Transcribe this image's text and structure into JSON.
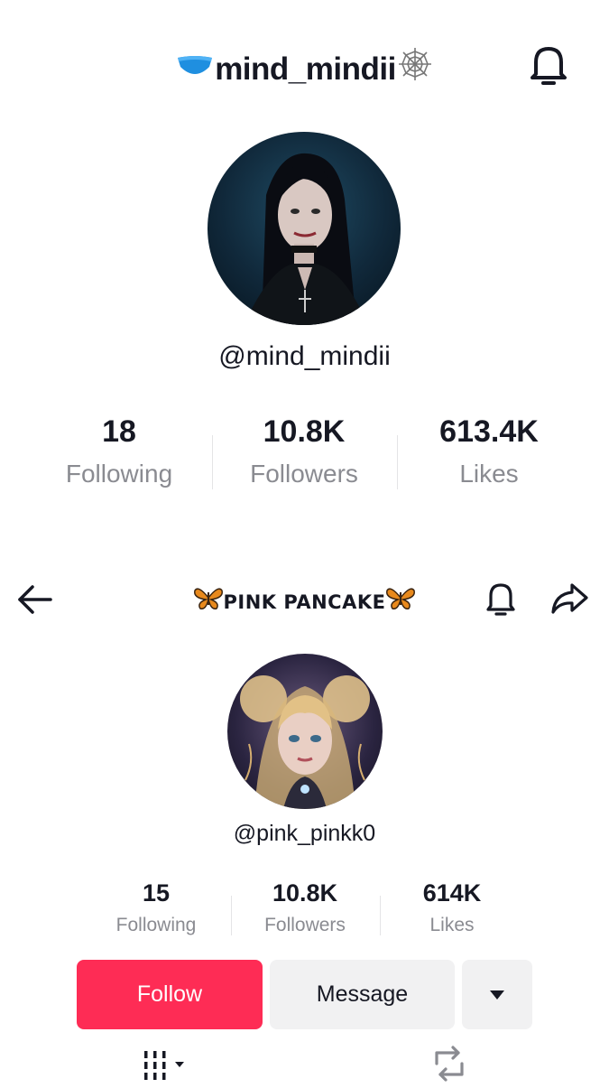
{
  "profile1": {
    "title": "mind_mindii",
    "title_prefix_icon": "blue-heart-emoji",
    "title_suffix_icon": "spider-web-emoji",
    "handle": "@mind_mindii",
    "stats": [
      {
        "value": "18",
        "label": "Following"
      },
      {
        "value": "10.8K",
        "label": "Followers"
      },
      {
        "value": "613.4K",
        "label": "Likes"
      }
    ],
    "icons": [
      "bell-icon",
      "avatar"
    ]
  },
  "profile2": {
    "title": "PINK PANCAKE",
    "title_decoration_icon": "butterfly-emoji",
    "handle": "@pink_pinkk0",
    "stats": [
      {
        "value": "15",
        "label": "Following"
      },
      {
        "value": "10.8K",
        "label": "Followers"
      },
      {
        "value": "614K",
        "label": "Likes"
      }
    ],
    "buttons": {
      "follow": "Follow",
      "message": "Message"
    },
    "icons": [
      "back-arrow-icon",
      "bell-icon",
      "share-icon",
      "caret-down-icon",
      "grid-tab-icon",
      "repost-tab-icon"
    ]
  },
  "colors": {
    "accent": "#fe2c55",
    "text": "#161823",
    "secondary_text": "#8a8b91",
    "button_gray": "#f1f1f2"
  }
}
